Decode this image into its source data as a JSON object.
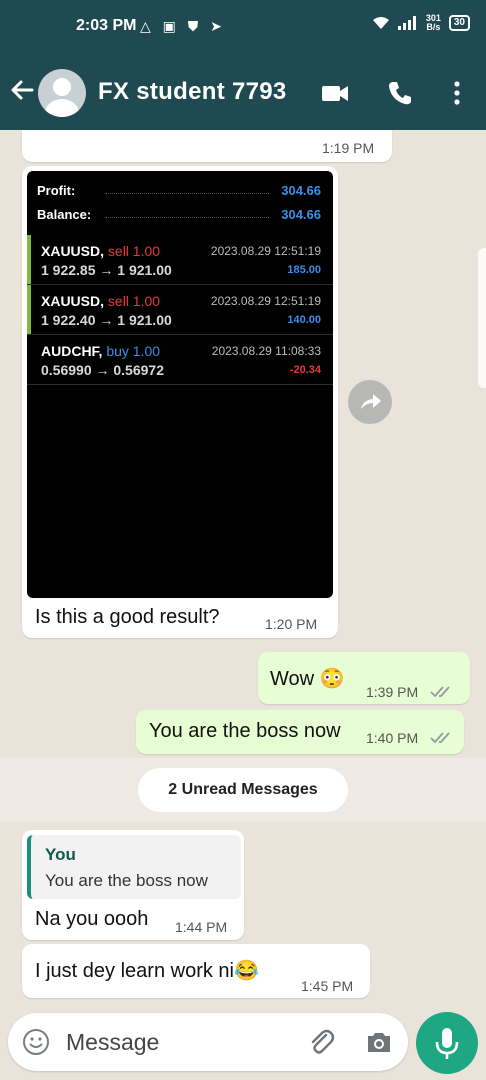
{
  "status": {
    "time": "2:03 PM",
    "icons": "△ ▣ ⛊ ➤",
    "speed_top": "301",
    "speed_bottom": "B/s",
    "battery": "30"
  },
  "header": {
    "title": "FX student 7793"
  },
  "messages": {
    "m0": {
      "time": "1:19 PM"
    },
    "m1": {
      "shot": {
        "profit_label": "Profit:",
        "profit_value": "304.66",
        "balance_label": "Balance:",
        "balance_value": "304.66",
        "trades": [
          {
            "symbol": "XAUUSD,",
            "side": "sell 1.00",
            "side_color": "#e03b3b",
            "prices": "1 922.85 → 1 921.00",
            "date": "2023.08.29 12:51:19",
            "pl": "185.00",
            "pl_color": "#3b8ee8"
          },
          {
            "symbol": "XAUUSD,",
            "side": "sell 1.00",
            "side_color": "#e03b3b",
            "prices": "1 922.40 → 1 921.00",
            "date": "2023.08.29 12:51:19",
            "pl": "140.00",
            "pl_color": "#3b8ee8"
          },
          {
            "symbol": "AUDCHF,",
            "side": "buy 1.00",
            "side_color": "#3b8ee8",
            "prices": "0.56990 → 0.56972",
            "date": "2023.08.29 11:08:33",
            "pl": "-20.34",
            "pl_color": "#e03b3b"
          }
        ]
      },
      "caption": "Is this a good result?",
      "time": "1:20 PM"
    },
    "m2": {
      "text": "Wow 😳",
      "time": "1:39 PM"
    },
    "m3": {
      "text": "You are the boss now",
      "time": "1:40 PM"
    },
    "unread": "2 Unread Messages",
    "m4": {
      "quote_name": "You",
      "quote_text": "You are the boss now",
      "text": "Na you oooh",
      "time": "1:44 PM"
    },
    "m5": {
      "text": "I just dey learn work ni😂",
      "time": "1:45 PM"
    }
  },
  "input": {
    "placeholder": "Message"
  },
  "colors": {
    "header": "#1f4a52",
    "accent": "#1da783",
    "outgoing": "#e7fed5",
    "read_ticks": "#8f9aa0"
  }
}
